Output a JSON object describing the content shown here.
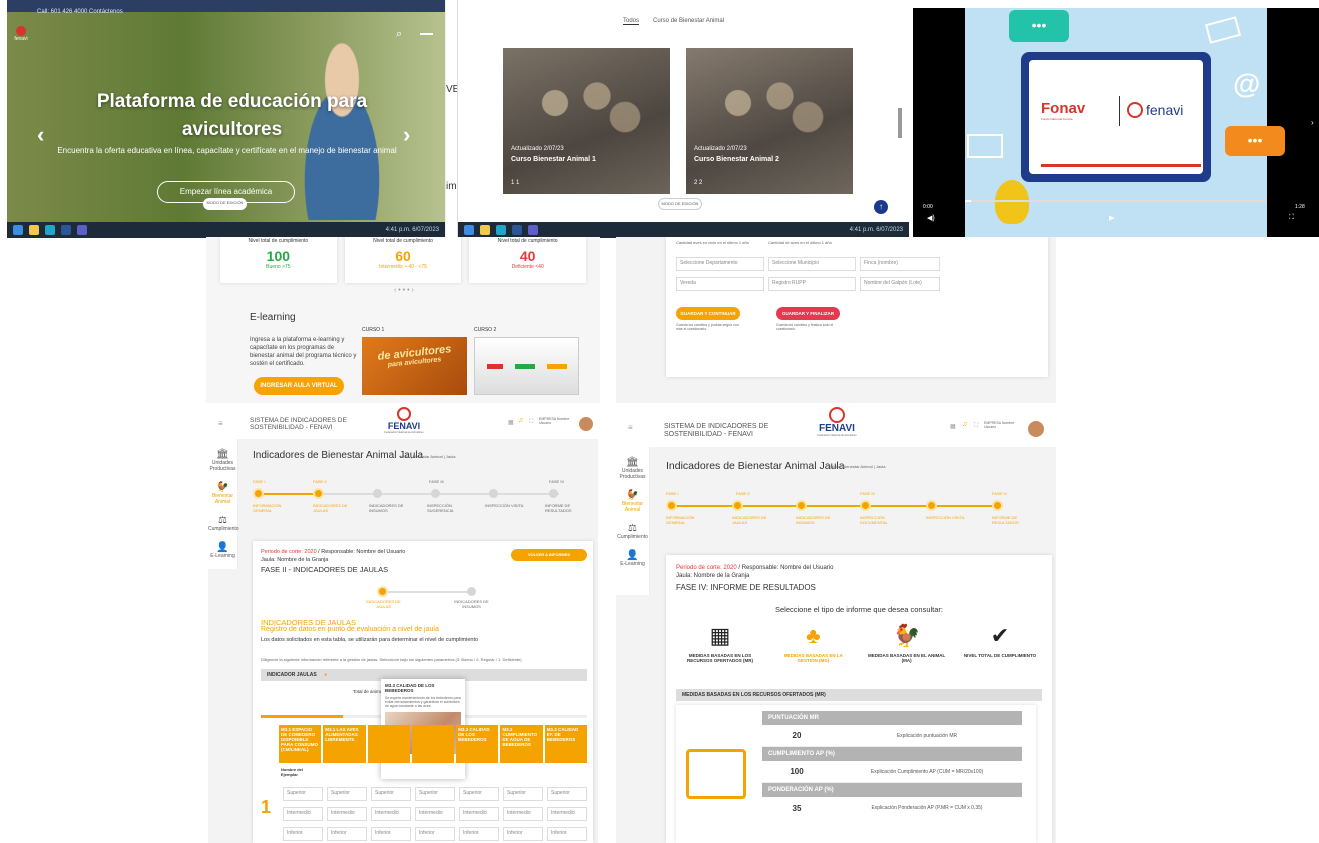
{
  "panel1": {
    "topbar": "Call: 601 426 4000   Contáctenos",
    "logo": "fenavi",
    "title": "Plataforma de educación para avicultores",
    "subtitle": "Encuentra la oferta educativa en línea, capacítate y certifícate en el manejo de bienestar animal",
    "cta": "Empezar línea académica",
    "badge": "MODO DE EDICIÓN",
    "side_letters": "VE",
    "side_letter2": "im",
    "taskbar_time": "4:41 p.m.\n6/07/2023"
  },
  "panel2": {
    "tab1": "Todos",
    "tab2": "Curso de Bienestar Animal",
    "course1": {
      "updated": "Actualizado 2/07/23",
      "title": "Curso Bienestar Animal 1",
      "meta": "1  1"
    },
    "course2": {
      "updated": "Actualizado 2/07/23",
      "title": "Curso Bienestar Animal 2",
      "meta": "2  2"
    },
    "badge": "MODO DE EDICIÓN",
    "taskbar_time": "4:41 p.m.\n6/07/2023"
  },
  "panel3": {
    "brand1": "Fonav",
    "brand1_sub": "Fondo Nacional Avícola",
    "brand2": "fenavi",
    "time_start": "0:00",
    "time_end": "1:28"
  },
  "panel4": {
    "scores": [
      {
        "label": "Nivel total de cumplimiento",
        "value": "100",
        "sub": "Bueno >75",
        "color": "#27a844"
      },
      {
        "label": "Nivel total de cumplimiento",
        "value": "60",
        "sub": "Intermedio > 40 - <75",
        "color": "#f5a300"
      },
      {
        "label": "Nivel total de cumplimiento",
        "value": "40",
        "sub": "Deficiente <40",
        "color": "#e53935"
      }
    ],
    "pager": "‹  • • •  ›",
    "elearning_title": "E-learning",
    "elearning_text": "Ingresa a la plataforma e-learning y capacítate en los programas de bienestar animal del programa técnico y sostén el certificado.",
    "elearning_btn": "INGRESAR AULA VIRTUAL",
    "course1_label": "CURSO 1",
    "course2_label": "CURSO 2",
    "course1_art": "de avicultores",
    "course1_art2": "para avicultores"
  },
  "panel5": {
    "hint1": "Cantidad aves en ciclo en el último 1 año",
    "hint2": "Cantidad de aves en el último 1 año",
    "fields": [
      "Seleccione Departamento",
      "Seleccione Municipio",
      "Finca (nombre)",
      "Vereda",
      "Registro RUPP",
      "Nombre del Galpón (Lote)"
    ],
    "btn1": "GUARDAR Y CONTINUAR",
    "btn2": "GUARDAR Y FINALIZAR",
    "note1": "Guarda los cambios y podrás seguir con más el cuestionario.",
    "note2": "Guarda los cambios y finaliza todo el cuestionario."
  },
  "panel6": {
    "system_title": "SISTEMA DE INDICADORES DE SOSTENIBILIDAD - FENAVI",
    "brand": "FENAVI",
    "brand_sub": "Federación Nacional de Avicultores",
    "user": "EMPRESA Nombre Usuario",
    "sidebar": [
      "Unidades Productivas",
      "Bienestar Animal",
      "Cumplimiento",
      "E-Learning"
    ],
    "page_title": "Indicadores de Bienestar Animal Jaula",
    "breadcrumb": "Inicio | Bienestar Animal | Jaula",
    "phases": [
      "FASE I",
      "FASE II",
      "FASE III",
      "FASE IV"
    ],
    "steps": [
      "INFORMACIÓN GENERAL",
      "INDICADORES DE JAULAS",
      "INDICADORES DE INSUMOS",
      "INSPECCIÓN SUGERENCIA",
      "INSPECCIÓN VISITA",
      "INFORME DE RESULTADOS"
    ],
    "period": "Periodo de corte: 2020",
    "resp": "Responsable: Nombre del Usuario",
    "farm": "Jaula: Nombre de la Granja",
    "btn": "VOLVER A INFORMES",
    "phase_title": "FASE II - INDICADORES DE JAULAS",
    "sub1": "INDICADORES DE JAULAS",
    "sub2": "INDICADORES DE INSUMOS",
    "ind_title": "INDICADORES DE JAULAS",
    "ind_sub": "Registro de datos en punto de evaluación a nivel de jaula",
    "ind_text": "Los datos solicitados en esta tabla, se utilizarán para determinar el nivel de cumplimiento",
    "ind_instr": "Diligencie la siguiente información referente a la gestión de jaulas. Seleccione bajo los siguientes parámetros (3. Bueno / 2. Regular / 1. Deficiente)",
    "indicator_bar": "INDICADOR JAULAS",
    "total": "Total de animales evaluados",
    "total_val": "9",
    "tooltip_title": "M3.3 CALIDAD DE LOS BEBEDEROS",
    "tooltip_text": "Se espera mantenimiento de los bebederos para evitar derramamientos y garantizar el suministro de agua constante a las aves.",
    "col_headers": [
      "M3.1 ESPACIO DE COMEDERO DISPONIBLE PARA CONSUMO (CM/LINEAL)",
      "M3.1 LAS AVES ALIMENTADAS LIBREMENTE",
      "",
      "",
      "M3.3 CALIDAD DE LOS BEBEDEROS",
      "M3.3 CUMPLIMIENTO DE AGUA DE BEBEDEROS",
      "M3.3 CALIDAD EF. DE BEBEDEROS"
    ],
    "row_name": "Nombre del Ejemplar",
    "row_labels": [
      "Superior",
      "Intermedio",
      "Inferior"
    ],
    "row_num": "1"
  },
  "panel7": {
    "system_title": "SISTEMA DE INDICADORES DE SOSTENIBILIDAD - FENAVI",
    "brand": "FENAVI",
    "brand_sub": "Federación Nacional de Avicultores",
    "user": "EMPRESA Nombre Usuario",
    "sidebar": [
      "Unidades Productivas",
      "Bienestar Animal",
      "Cumplimiento",
      "E-Learning"
    ],
    "page_title": "Indicadores de Bienestar Animal Jaula",
    "breadcrumb": "Inicio | Bienestar Animal | Jaula",
    "phases": [
      "FASE I",
      "FASE II",
      "FASE III",
      "FASE IV"
    ],
    "steps": [
      "INFORMACIÓN GENERAL",
      "INDICADORES DE JAULAS",
      "INDICADORES DE INSUMOS",
      "INSPECCIÓN DOCUMENTAL",
      "INSPECCIÓN VISITA",
      "INFORME DE RESULTADOS"
    ],
    "period": "Periodo de corte: 2020",
    "resp": "Responsable: Nombre del Usuario",
    "farm": "Jaula: Nombre de la Granja",
    "phase_title": "FASE IV: INFORME DE RESULTADOS",
    "select_text": "Seleccione el tipo de informe que desea consultar:",
    "report_types": [
      "MEDIDAS BASADAS EN LOS RECURSOS OFERTADOS (MR)",
      "MEDIDAS BASADAS EN LA GESTIÓN (MG)",
      "MEDIDAS BASADAS EN EL ANIMAL (MA)",
      "NIVEL TOTAL DE CUMPLIMIENTO"
    ],
    "section_bar": "MEDIDAS BASADAS EN LOS RECURSOS OFERTADOS (MR)",
    "rows": [
      {
        "header": "PUNTUACIÓN MR",
        "value": "20",
        "expl": "Explicación puntuación MR"
      },
      {
        "header": "CUMPLIMIENTO AP (%)",
        "value": "100",
        "expl": "Explicación Cumplimiento AP (CUM = MR/20x100)"
      },
      {
        "header": "PONDERACIÓN AP (%)",
        "value": "35",
        "expl": "Explicación Ponderación AP (P.MR = CUM x 0,35)"
      }
    ]
  }
}
